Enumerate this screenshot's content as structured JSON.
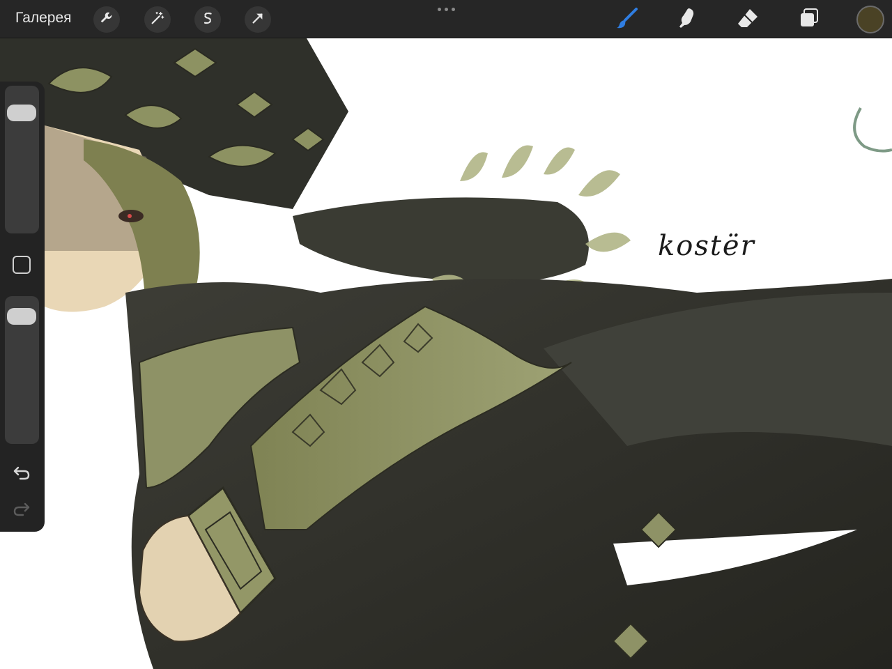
{
  "toolbar": {
    "gallery_label": "Галерея",
    "left_tools": [
      "wrench-icon",
      "magic-wand-icon",
      "selection-s-icon",
      "transform-arrow-icon"
    ],
    "right_tools": [
      "brush-icon",
      "smudge-icon",
      "eraser-icon",
      "layers-icon"
    ],
    "active_tool": "brush-icon",
    "active_color": "#4a4225",
    "accent_color": "#2f7de1"
  },
  "sidebar": {
    "brush_size_level": 0.12,
    "opacity_level": 0.06,
    "buttons": [
      "modify-button",
      "undo-icon",
      "redo-icon"
    ]
  },
  "canvas": {
    "signature_text": "kostër"
  }
}
